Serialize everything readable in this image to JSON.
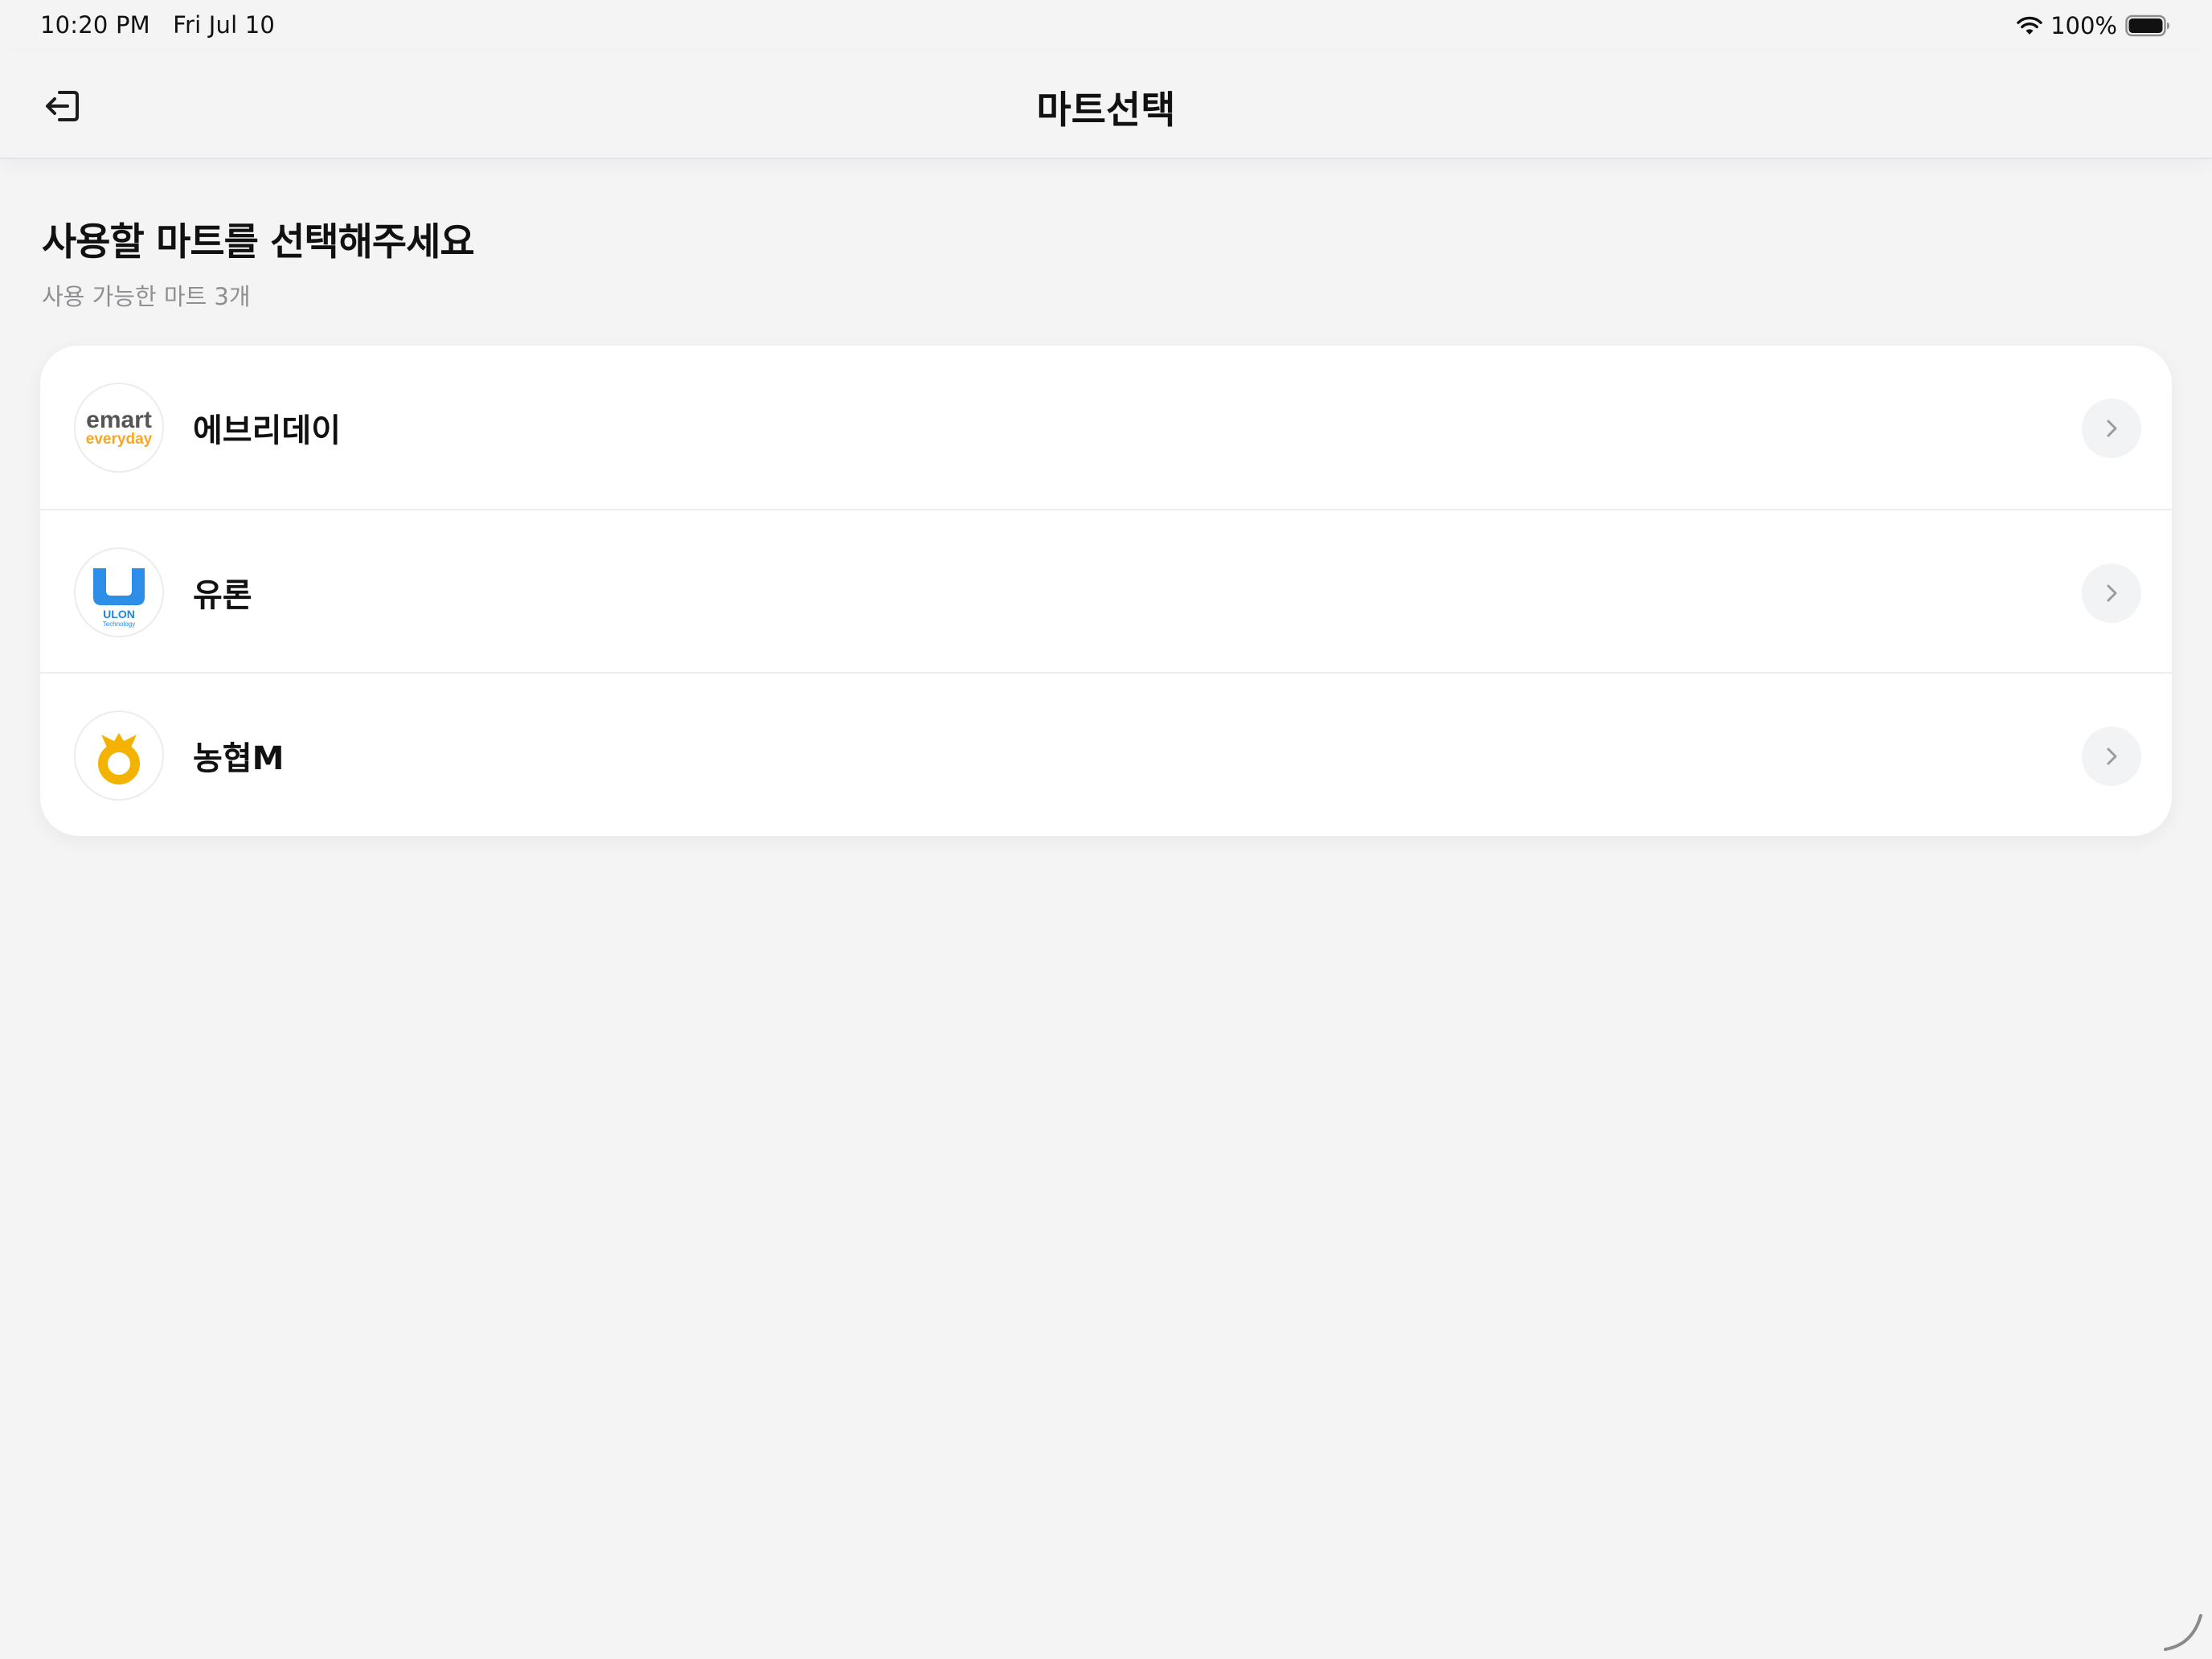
{
  "status_bar": {
    "time": "10:20 PM",
    "date": "Fri Jul 10",
    "battery": "100%"
  },
  "nav": {
    "title": "마트선택",
    "back_icon": "logout-icon"
  },
  "content": {
    "heading": "사용할 마트를 선택해주세요",
    "subheading": "사용 가능한 마트 3개"
  },
  "marts": [
    {
      "name": "에브리데이",
      "logo": "emart-everyday-logo",
      "logo_text_top": "emart",
      "logo_text_bottom": "everyday",
      "color": "#f5a623"
    },
    {
      "name": "유론",
      "logo": "ulon-logo",
      "logo_text_top": "ULON",
      "logo_text_bottom": "Technology",
      "color": "#1f86e8"
    },
    {
      "name": "농협M",
      "logo": "nonghyup-logo",
      "color": "#f5b301"
    }
  ],
  "colors": {
    "background": "#f4f4f4",
    "card": "#ffffff",
    "subtext": "#8e8e93",
    "chevron_bg": "#f2f3f5"
  }
}
